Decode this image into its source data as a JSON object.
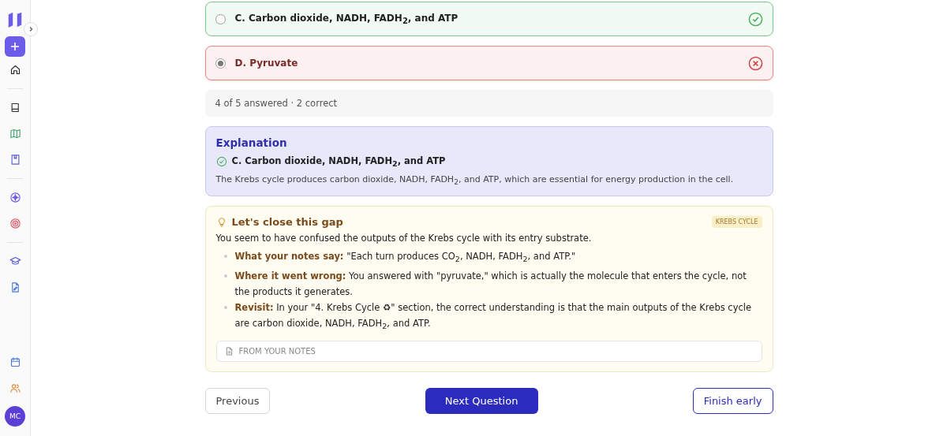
{
  "sidebar": {
    "avatar": "MC"
  },
  "options": [
    {
      "text": "C. Carbon dioxide, NADH, FADH$_{2}$, and ATP",
      "selected": false,
      "kind": "correct"
    },
    {
      "text": "D. Pyruvate",
      "selected": true,
      "kind": "incorrect"
    }
  ],
  "progress": "4 of 5 answered · 2 correct",
  "explanation": {
    "title": "Explanation",
    "answer": "C. Carbon dioxide, NADH, FADH$_{2}$, and ATP",
    "text": "The Krebs cycle produces carbon dioxide, NADH, FADH$_{2}$, and ATP, which are essential for energy production in the cell."
  },
  "gap": {
    "title": "Let's close this gap",
    "tag": "KREBS CYCLE",
    "intro": "You seem to have confused the outputs of the Krebs cycle with its entry substrate.",
    "points": [
      "**What your notes say:** \"Each turn produces CO$_{2}$, NADH, FADH$_{2}$, and ATP.\"",
      "**Where it went wrong:** You answered with \"pyruvate,\" which is actually the molecule that enters the cycle, not the products it generates.",
      "**Revisit:** In your \"4. Krebs Cycle ♻\" section, the correct understanding is that the main outputs of the Krebs cycle are carbon dioxide, NADH, FADH$_{2}$, and ATP."
    ],
    "notes_label": "FROM YOUR NOTES"
  },
  "buttons": {
    "previous": "Previous",
    "next": "Next Question",
    "finish": "Finish early"
  }
}
